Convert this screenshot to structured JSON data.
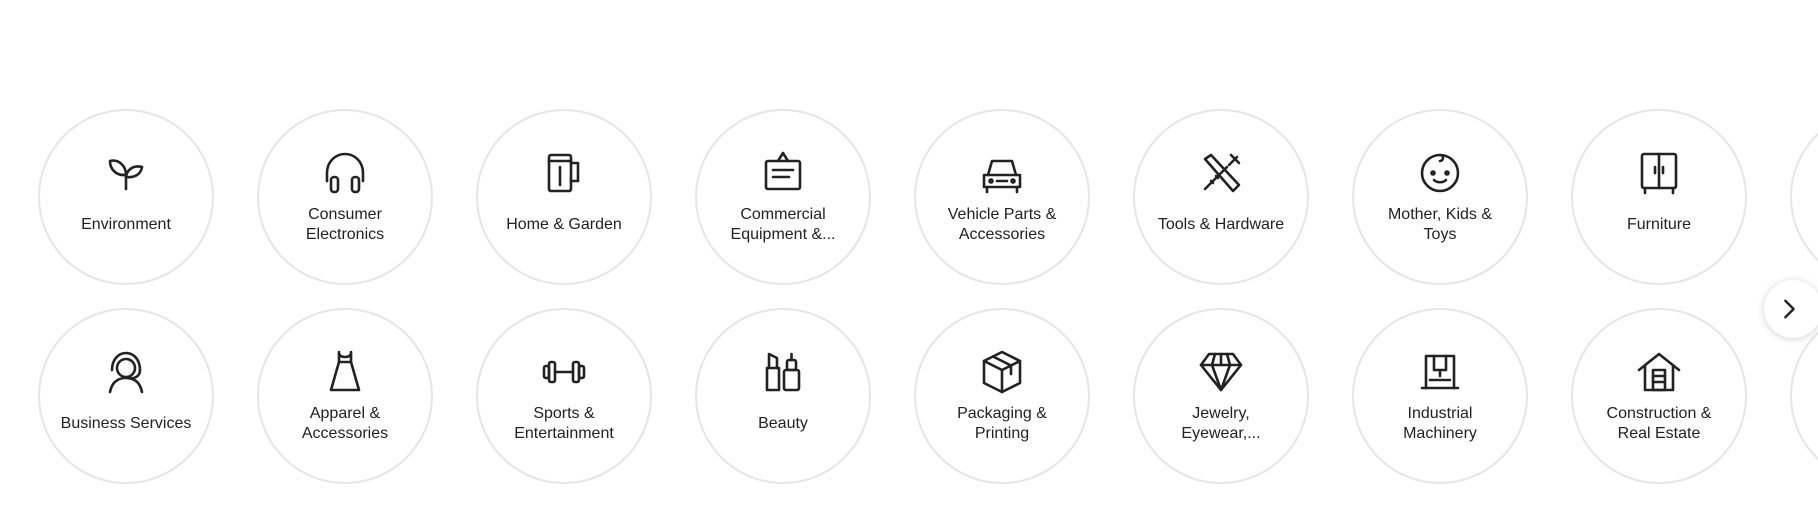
{
  "categories": {
    "row1": [
      {
        "label": "Environment",
        "icon": "sprout-icon"
      },
      {
        "label": "Consumer Electronics",
        "icon": "headphones-icon"
      },
      {
        "label": "Home & Garden",
        "icon": "mug-icon"
      },
      {
        "label": "Commercial Equipment &...",
        "icon": "clipboard-icon"
      },
      {
        "label": "Vehicle Parts & Accessories",
        "icon": "car-icon"
      },
      {
        "label": "Tools & Hardware",
        "icon": "tools-icon"
      },
      {
        "label": "Mother, Kids & Toys",
        "icon": "baby-face-icon"
      },
      {
        "label": "Furniture",
        "icon": "wardrobe-icon"
      }
    ],
    "row2": [
      {
        "label": "Business Services",
        "icon": "headset-person-icon"
      },
      {
        "label": "Apparel & Accessories",
        "icon": "dress-icon"
      },
      {
        "label": "Sports & Entertainment",
        "icon": "dumbbell-icon"
      },
      {
        "label": "Beauty",
        "icon": "cosmetics-icon"
      },
      {
        "label": "Packaging & Printing",
        "icon": "box-icon"
      },
      {
        "label": "Jewelry, Eyewear,...",
        "icon": "diamond-icon"
      },
      {
        "label": "Industrial Machinery",
        "icon": "machine-icon"
      },
      {
        "label": "Construction & Real Estate",
        "icon": "house-icon"
      }
    ]
  },
  "carousel": {
    "next_icon": "chevron-right-icon"
  },
  "colors": {
    "circle_border": "#e6e6e6",
    "text": "#222222",
    "background": "#ffffff"
  }
}
